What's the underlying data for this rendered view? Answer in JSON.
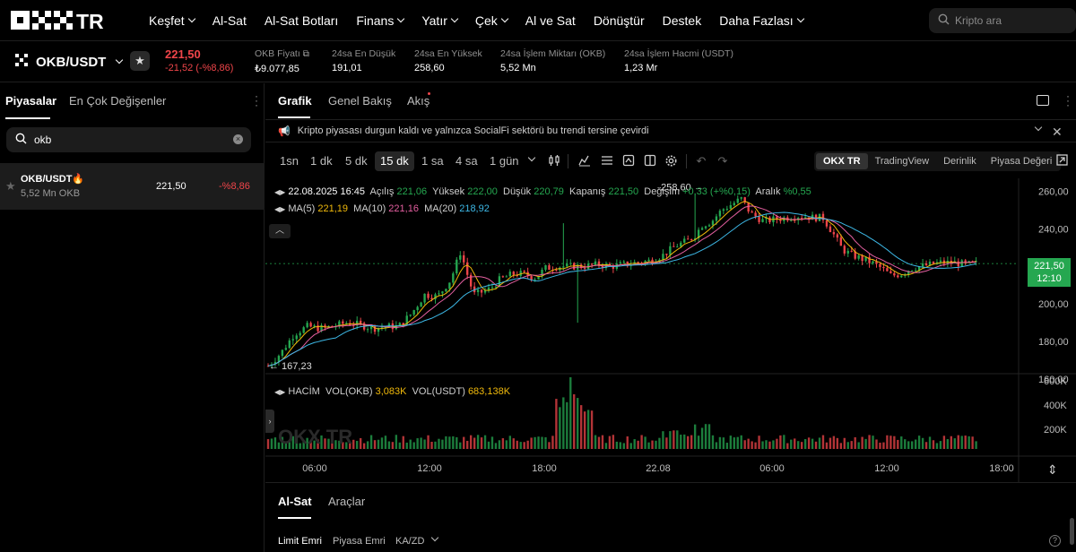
{
  "brand": {
    "logo_text": "OKX TR"
  },
  "nav": {
    "items": [
      {
        "label": "Keşfet",
        "dropdown": true
      },
      {
        "label": "Al-Sat",
        "dropdown": false
      },
      {
        "label": "Al-Sat Botları",
        "dropdown": false
      },
      {
        "label": "Finans",
        "dropdown": true
      },
      {
        "label": "Yatır",
        "dropdown": true
      },
      {
        "label": "Çek",
        "dropdown": true
      },
      {
        "label": "Al ve Sat",
        "dropdown": false
      },
      {
        "label": "Dönüştür",
        "dropdown": false
      },
      {
        "label": "Destek",
        "dropdown": false
      },
      {
        "label": "Daha Fazlası",
        "dropdown": true
      }
    ],
    "search_placeholder": "Kripto ara"
  },
  "ticker": {
    "pair": "OKB/USDT",
    "price": "221,50",
    "change": "-21,52 (-%8,86)",
    "stats": [
      {
        "label": "OKB Fiyatı",
        "value": "₺9.077,85"
      },
      {
        "label": "24sa En Düşük",
        "value": "191,01"
      },
      {
        "label": "24sa En Yüksek",
        "value": "258,60"
      },
      {
        "label": "24sa İşlem Miktarı (OKB)",
        "value": "5,52 Mn"
      },
      {
        "label": "24sa İşlem Hacmi (USDT)",
        "value": "1,23 Mr"
      }
    ]
  },
  "left_panel": {
    "tabs": [
      "Piyasalar",
      "En Çok Değişenler"
    ],
    "search_value": "okb",
    "market_rows": [
      {
        "pair": "OKB/USDT",
        "volume": "5,52 Mn OKB",
        "price": "221,50",
        "change": "-%8,86"
      }
    ]
  },
  "chart_tabs": [
    "Grafik",
    "Genel Bakış",
    "Akış"
  ],
  "announcement": "Kripto piyasası durgun kaldı ve yalnızca SocialFi sektörü bu trendi tersine çevirdi",
  "timeframes": [
    "1sn",
    "1 dk",
    "5 dk",
    "15 dk",
    "1 sa",
    "4 sa",
    "1 gün"
  ],
  "active_timeframe": "15 dk",
  "views": [
    "OKX TR",
    "TradingView",
    "Derinlik",
    "Piyasa Değeri"
  ],
  "active_view": "OKX TR",
  "ohlc": {
    "datetime": "22.08.2025 16:45",
    "open_label": "Açılış",
    "open": "221,06",
    "high_label": "Yüksek",
    "high": "222,00",
    "low_label": "Düşük",
    "low": "220,79",
    "close_label": "Kapanış",
    "close": "221,50",
    "change_label": "Değişim",
    "change": "+0,33 (+%0,15)",
    "range_label": "Aralık",
    "range": "%0,55"
  },
  "ma": {
    "ma5_label": "MA(5)",
    "ma5": "221,19",
    "ma10_label": "MA(10)",
    "ma10": "221,16",
    "ma20_label": "MA(20)",
    "ma20": "218,92"
  },
  "volume_legend": {
    "title": "HACİM",
    "okb_label": "VOL(OKB)",
    "okb": "3,083K",
    "usdt_label": "VOL(USDT)",
    "usdt": "683,138K"
  },
  "price_tag": {
    "price": "221,50",
    "countdown": "12:10"
  },
  "annotations": {
    "high": "258,60",
    "low": "167,23"
  },
  "colors": {
    "up": "#25a750",
    "down": "#ef454a",
    "ma5": "#f0b90b",
    "ma10": "#e45fa0",
    "ma20": "#3db8e6"
  },
  "chart_data": {
    "type": "candlestick",
    "price_axis": {
      "ticks": [
        "260,00",
        "240,00",
        "220,00",
        "200,00",
        "180,00",
        "160,00"
      ],
      "ylim": [
        160,
        265
      ]
    },
    "volume_axis": {
      "ticks": [
        "600K",
        "400K",
        "200K"
      ]
    },
    "time_axis": {
      "ticks": [
        "06:00",
        "12:00",
        "18:00",
        "22.08",
        "06:00",
        "12:00",
        "18:00"
      ]
    },
    "series_description": "15-minute OKB/USDT candles rising from 167,23 to a peak of 258,60 then settling near 221,50",
    "close_path": [
      [
        0,
        167
      ],
      [
        8,
        174
      ],
      [
        16,
        184
      ],
      [
        24,
        188
      ],
      [
        32,
        187
      ],
      [
        40,
        188
      ],
      [
        48,
        190
      ],
      [
        56,
        189
      ],
      [
        64,
        187
      ],
      [
        72,
        188
      ],
      [
        80,
        188
      ],
      [
        88,
        195
      ],
      [
        96,
        205
      ],
      [
        104,
        204
      ],
      [
        112,
        213
      ],
      [
        118,
        228
      ],
      [
        122,
        216
      ],
      [
        126,
        205
      ],
      [
        130,
        206
      ],
      [
        136,
        208
      ],
      [
        142,
        213
      ],
      [
        150,
        216
      ],
      [
        156,
        216
      ],
      [
        164,
        214
      ],
      [
        170,
        219
      ],
      [
        178,
        220
      ],
      [
        186,
        220
      ],
      [
        194,
        220
      ],
      [
        202,
        221
      ],
      [
        210,
        220
      ],
      [
        218,
        221
      ],
      [
        226,
        222
      ],
      [
        234,
        223
      ],
      [
        242,
        226
      ],
      [
        250,
        231
      ],
      [
        258,
        234
      ],
      [
        262,
        237
      ],
      [
        266,
        242
      ],
      [
        272,
        244
      ],
      [
        278,
        250
      ],
      [
        284,
        253
      ],
      [
        290,
        256
      ],
      [
        296,
        248
      ],
      [
        304,
        244
      ],
      [
        310,
        245
      ],
      [
        318,
        246
      ],
      [
        326,
        247
      ],
      [
        334,
        246
      ],
      [
        340,
        246
      ],
      [
        346,
        238
      ],
      [
        352,
        229
      ],
      [
        358,
        226
      ],
      [
        364,
        224
      ],
      [
        370,
        222
      ],
      [
        376,
        219
      ],
      [
        382,
        215
      ],
      [
        388,
        216
      ],
      [
        394,
        219
      ],
      [
        400,
        220
      ],
      [
        406,
        221
      ],
      [
        412,
        222
      ],
      [
        420,
        222
      ],
      [
        428,
        221
      ],
      [
        434,
        221.5
      ]
    ]
  }
}
